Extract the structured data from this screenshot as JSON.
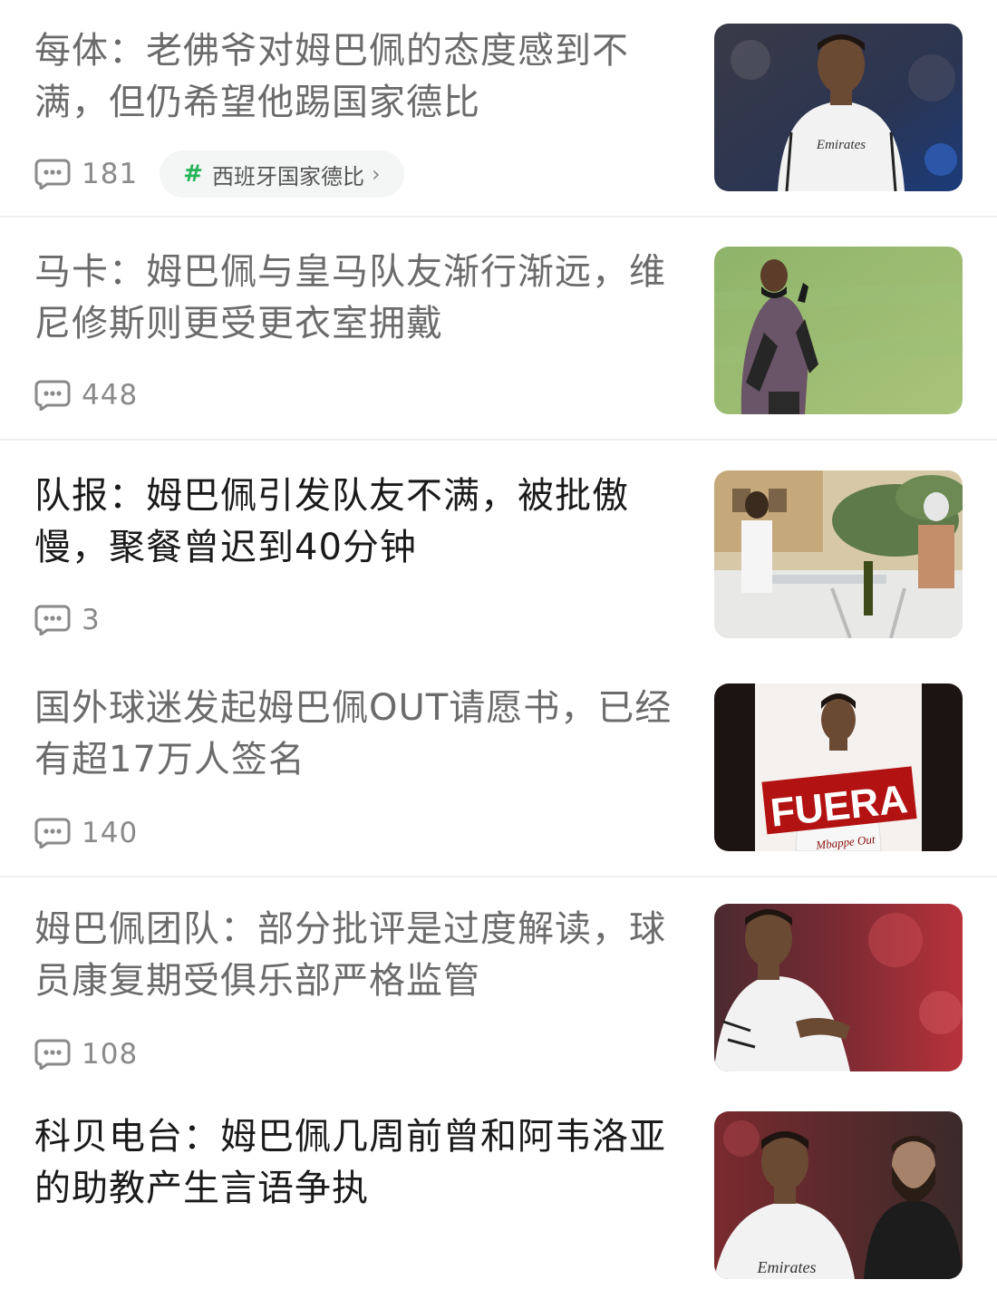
{
  "articles": [
    {
      "title": "每体：老佛爷对姆巴佩的态度感到不满，但仍希望他踢国家德比",
      "comments": "181",
      "topic": "西班牙国家德比",
      "image_alt": "photo of a player in a white jersey",
      "read": true
    },
    {
      "title": "马卡：姆巴佩与皇马队友渐行渐远，维尼修斯则更受更衣室拥戴",
      "comments": "448",
      "image_alt": "player in training jacket on pitch",
      "read": true
    },
    {
      "title": "队报：姆巴佩引发队友不满，被批傲慢，聚餐曾迟到40分钟",
      "comments": "3",
      "image_alt": "outdoor restaurant scene",
      "read": false
    },
    {
      "title": "国外球迷发起姆巴佩OUT请愿书，已经有超17万人签名",
      "comments": "140",
      "image_alt": "poster with fuera text",
      "image_text": "FUERA",
      "image_subtext": "Mbappe Out",
      "read": true
    },
    {
      "title": "姆巴佩团队：部分批评是过度解读，球员康复期受俱乐部严格监管",
      "comments": "108",
      "image_alt": "player in white jersey at night match",
      "read": true
    },
    {
      "title": "科贝电台：姆巴佩几周前曾和阿韦洛亚的助教产生言语争执",
      "image_alt": "player and bearded coach",
      "read": false
    }
  ],
  "colors": {
    "accent_green": "#27b35a",
    "title_read": "#6b6b6b",
    "title_unread": "#1a1a1a",
    "meta_gray": "#8a8a8a"
  },
  "icons": {
    "comment": "comment-bubble-icon",
    "topic": "hash-icon",
    "chevron": "chevron-right-icon"
  }
}
